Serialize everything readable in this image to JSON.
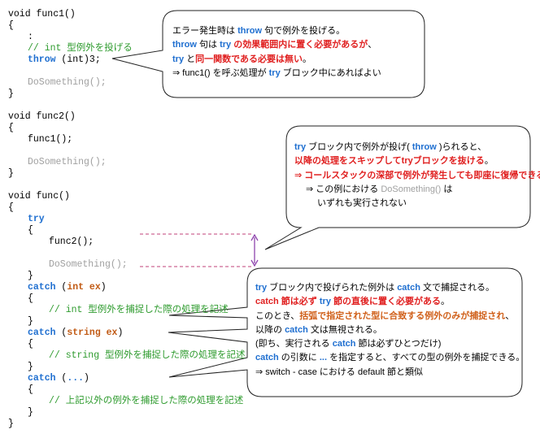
{
  "code": {
    "func1_sig": "void func1()",
    "func1_open": "{",
    "func1_colon": ":",
    "func1_comment": "// int 型例外を投げる",
    "func1_throw_kw": "throw",
    "func1_throw_rest": " (int)3;",
    "func1_dosomething": "DoSomething();",
    "func1_close": "}",
    "func2_sig": "void func2()",
    "func2_open": "{",
    "func2_call": "func1();",
    "func2_dosomething": "DoSomething();",
    "func2_close": "}",
    "func_sig": "void func()",
    "func_open": "{",
    "try_kw": "try",
    "try_open": "{",
    "try_call": "func2();",
    "try_dosomething": "DoSomething();",
    "try_close": "}",
    "catch1_kw": "catch",
    "catch1_lp": " (",
    "catch1_param": "int ex",
    "catch1_rp": ")",
    "catch1_open": "{",
    "catch1_comment": "// int 型例外を捕捉した際の処理を記述",
    "catch1_close": "}",
    "catch2_kw": "catch",
    "catch2_lp": " (",
    "catch2_param": "string ex",
    "catch2_rp": ")",
    "catch2_open": "{",
    "catch2_comment": "// string 型例外を捕捉した際の処理を記述",
    "catch2_close": "}",
    "catch3_kw": "catch",
    "catch3_lp": " (",
    "catch3_param": "...",
    "catch3_rp": ")",
    "catch3_open": "{",
    "catch3_comment": "// 上記以外の例外を捕捉した際の処理を記述",
    "catch3_close": "}",
    "func_close": "}"
  },
  "callout1": {
    "l1": "エラー発生時は ",
    "l1_kw": "throw",
    "l1_b": " 句で例外を投げる。",
    "l2_kw": "throw",
    "l2_b": " 句は ",
    "l2_kw2": "try",
    "l2_red": " の効果範囲内に置く必要があるが",
    "l2_c": "、",
    "l3_kw": "try",
    "l3_b": " と",
    "l3_red": "同一関数である必要は無い",
    "l3_c": "。",
    "l4_a": "⇒ func1() を呼ぶ処理が ",
    "l4_kw": "try",
    "l4_b": " ブロック中にあればよい"
  },
  "callout2": {
    "l1_kw": "try",
    "l1_a": " ブロック内で例外が投げ( ",
    "l1_kw2": "throw",
    "l1_b": " )られると、",
    "l2_red": "以降の処理をスキップして",
    "l2_kw": "try",
    "l2_red2": "ブロックを抜ける",
    "l2_c": "。",
    "l3_red": "⇒ コールスタックの深部で例外が発生しても即座に復帰できる",
    "l4_a": "⇒ この例における ",
    "l4_faint": "DoSomething()",
    "l4_b": " は",
    "l5": "いずれも実行されない"
  },
  "callout3": {
    "l1_kw": "try",
    "l1_a": " ブロック内で投げられた例外は ",
    "l1_kw2": "catch",
    "l1_b": " 文で捕捉される。",
    "l2_red": "catch",
    "l2_red_b": " 節は必ず ",
    "l2_kw": "try",
    "l2_red_c": " 節の直後に置く必要がある",
    "l2_c": "。",
    "l3_a": "このとき、",
    "l3_orange": "括弧で指定された型に合致する例外のみが捕捉され",
    "l3_b": "、",
    "l4_a": "以降の ",
    "l4_kw": "catch",
    "l4_b": " 文は無視される。",
    "l5_a": "(即ち、実行される ",
    "l5_kw": "catch",
    "l5_b": " 節は必ずひとつだけ)",
    "l6_kw": "catch",
    "l6_a": " の引数に ",
    "l6_kw2": "...",
    "l6_b": " を指定すると、すべての型の例外を捕捉できる。",
    "l7": "⇒ switch - case における default 節と類似"
  },
  "colors": {
    "keyword": "#1f6fd0",
    "type": "#c15a14",
    "comment": "#2e9b2e",
    "emphasis": "#e02020",
    "arrow": "#8e44ad"
  }
}
